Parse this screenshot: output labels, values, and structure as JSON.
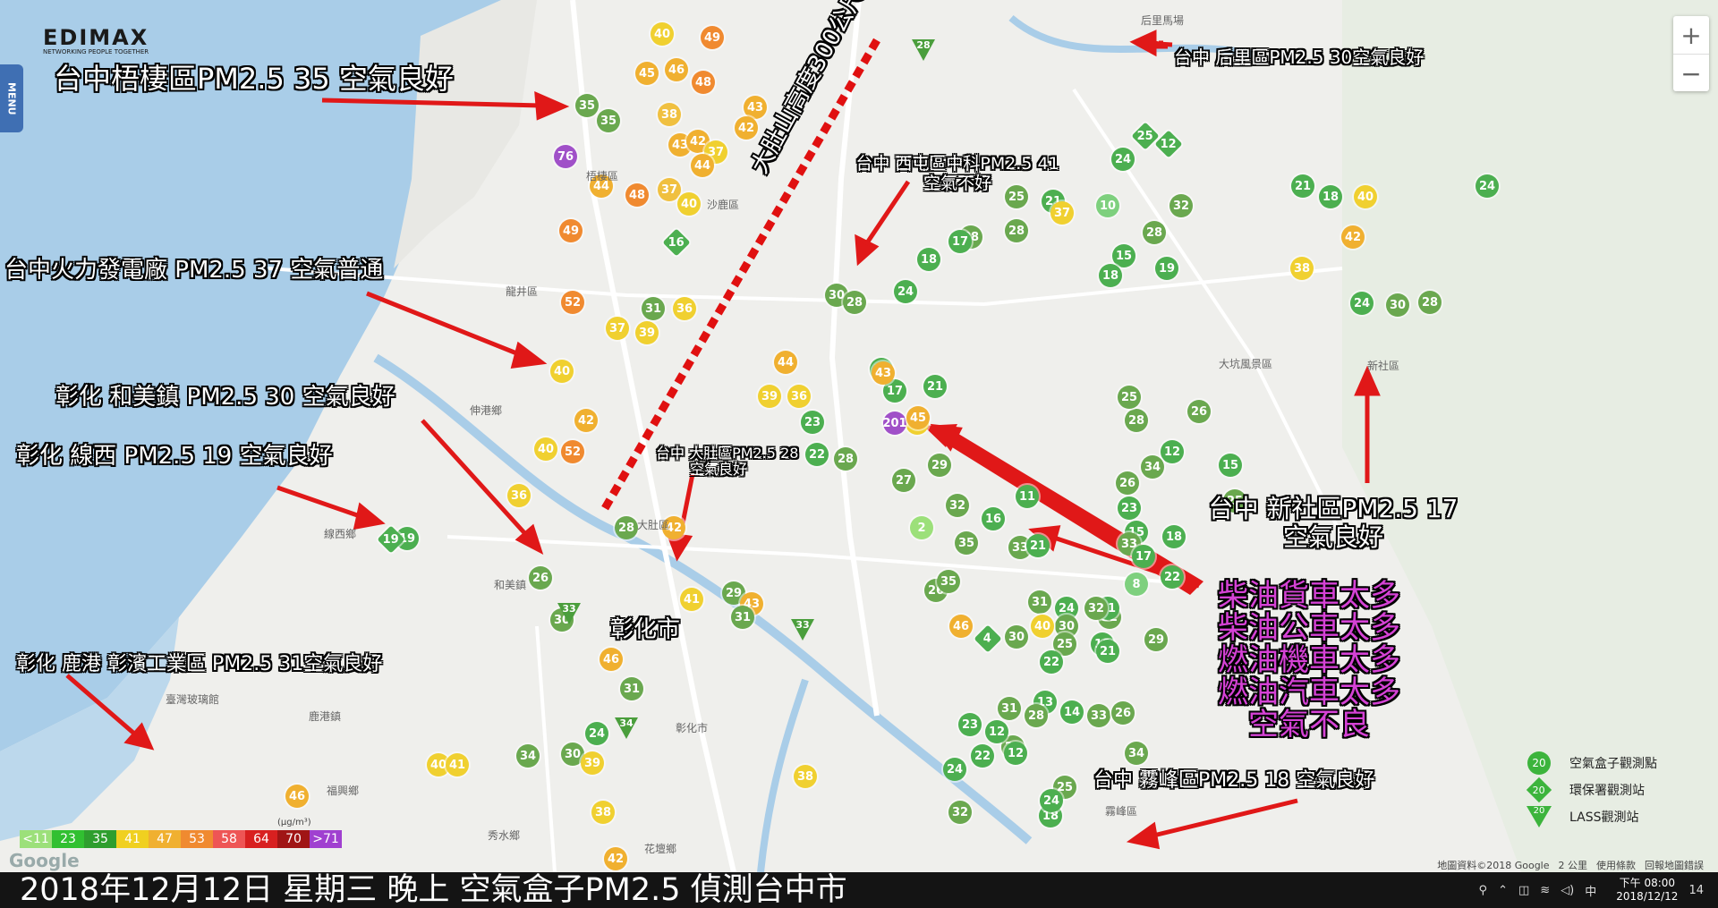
{
  "window": {
    "title": "空氣盒子PM2.5 地圖"
  },
  "brand": {
    "name": "EDIMAX",
    "tagline": "NETWORKING PEOPLE TOGETHER"
  },
  "menu_label": "MENU",
  "zoom": {
    "in": "+",
    "out": "−"
  },
  "annotations": {
    "wuqi": "台中梧棲區PM2.5  35 空氣良好",
    "power": "台中火力發電廠 PM2.5 37  空氣普通",
    "hemei": "彰化 和美鎮 PM2.5 30 空氣良好",
    "xianxi": "彰化 線西 PM2.5 19 空氣良好",
    "lukang": "彰化 鹿港 彰濱工業區 PM2.5 31空氣良好",
    "changhua": "彰化市",
    "dadu_line": "大肚山高度300公尺",
    "dadu": "台中 大肚區PM2.5 28",
    "dadu2": "空氣良好",
    "xitun": "台中 西屯區中科PM2.5 41",
    "xitun2": "空氣不好",
    "houli": "台中 后里區PM2.5 30空氣良好",
    "xinshe": "台中 新社區PM2.5 17",
    "xinshe2": "空氣良好",
    "causes": [
      "柴油貨車太多",
      "柴油公車太多",
      "燃油機車太多",
      "燃油汽車太多",
      "空氣不良"
    ],
    "wufeng": "台中 霧峰區PM2.5 18 空氣良好"
  },
  "map_labels": {
    "wuqi_town": "梧棲區",
    "shalu": "沙鹿區",
    "longjing": "龍井區",
    "shengang": "伸港鄉",
    "xianxi_town": "線西鄉",
    "dadu_town": "大肚區",
    "lukang_town": "鹿港鎮",
    "changhua_city": "彰化市",
    "dakeng": "大坑風景區",
    "xinshe_town": "新社區",
    "wufeng_town": "霧峰區",
    "houli_ranch": "后里馬場",
    "xiushui": "秀水鄉",
    "huatan": "花壇鄉",
    "hemei_town": "和美鎮",
    "fuxing": "福興鄉",
    "taiwan_glass": "臺灣玻璃館"
  },
  "legend": {
    "unit": "(μg/m³)",
    "items": [
      {
        "label": "<11",
        "color": "#9ce07a"
      },
      {
        "label": "23",
        "color": "#31c031"
      },
      {
        "label": "35",
        "color": "#2e9e2e"
      },
      {
        "label": "41",
        "color": "#f0d020"
      },
      {
        "label": "47",
        "color": "#f0b030"
      },
      {
        "label": "53",
        "color": "#f08a30"
      },
      {
        "label": "58",
        "color": "#ee5555"
      },
      {
        "label": "64",
        "color": "#d82020"
      },
      {
        "label": "70",
        "color": "#a01515"
      },
      {
        "label": ">71",
        "color": "#a040d0"
      }
    ]
  },
  "key": {
    "airbox": {
      "label": "空氣盒子觀測點",
      "value": "20"
    },
    "epa": {
      "label": "環保署觀測站",
      "value": "20"
    },
    "lass": {
      "label": "LASS觀測站",
      "value": "20"
    }
  },
  "attribution": {
    "data": "地圖資料©2018 Google",
    "scale": "2 公里",
    "terms": "使用條款",
    "report": "回報地圖錯誤"
  },
  "google": "Google",
  "footer": {
    "caption": "2018年12月12日 星期三  晚上 空氣盒子PM2.5 偵測台中市",
    "ime": "中",
    "time": "下午 08:00",
    "date": "2018/12/12",
    "notif": "14"
  },
  "pins": [
    {
      "v": "35",
      "c": "#6aa84f"
    },
    {
      "v": "35",
      "c": "#6aa84f"
    },
    {
      "v": "76",
      "c": "#a050c8"
    },
    {
      "v": "44",
      "c": "#f0b030"
    },
    {
      "v": "48",
      "c": "#f08a30"
    },
    {
      "v": "37",
      "c": "#f0c040"
    },
    {
      "v": "49",
      "c": "#f08a30"
    },
    {
      "v": "40",
      "c": "#f0d030"
    },
    {
      "v": "49",
      "c": "#f08a30"
    },
    {
      "v": "52",
      "c": "#f08a30"
    },
    {
      "v": "45",
      "c": "#f0b030"
    },
    {
      "v": "46",
      "c": "#f0b030"
    },
    {
      "v": "48",
      "c": "#f08a30"
    },
    {
      "v": "38",
      "c": "#f0c040"
    },
    {
      "v": "43",
      "c": "#f0b030"
    },
    {
      "v": "42",
      "c": "#f0b030"
    },
    {
      "v": "43",
      "c": "#f0b030"
    },
    {
      "v": "42",
      "c": "#f0b030"
    },
    {
      "v": "37",
      "c": "#f0d030"
    },
    {
      "v": "44",
      "c": "#f0b030"
    },
    {
      "v": "40",
      "c": "#f0d030"
    },
    {
      "v": "31",
      "c": "#6aa84f"
    },
    {
      "v": "36",
      "c": "#f0d030"
    },
    {
      "v": "39",
      "c": "#f0d030"
    },
    {
      "v": "37",
      "c": "#f0d030"
    },
    {
      "v": "40",
      "c": "#f0d030"
    },
    {
      "v": "42",
      "c": "#f0b030"
    },
    {
      "v": "40",
      "c": "#f0d030"
    },
    {
      "v": "52",
      "c": "#f08a30"
    },
    {
      "v": "36",
      "c": "#f0d030"
    },
    {
      "v": "28",
      "c": "#6aa84f"
    },
    {
      "v": "42",
      "c": "#f0b030"
    },
    {
      "v": "30",
      "c": "#6aa84f"
    },
    {
      "v": "26",
      "c": "#6aa84f"
    },
    {
      "v": "19",
      "c": "#4caf50"
    },
    {
      "v": "41",
      "c": "#f0d030"
    },
    {
      "v": "29",
      "c": "#6aa84f"
    },
    {
      "v": "43",
      "c": "#f0b030"
    },
    {
      "v": "46",
      "c": "#f0b030"
    },
    {
      "v": "31",
      "c": "#6aa84f"
    },
    {
      "v": "24",
      "c": "#4caf50"
    },
    {
      "v": "30",
      "c": "#6aa84f"
    },
    {
      "v": "39",
      "c": "#f0d030"
    },
    {
      "v": "34",
      "c": "#6aa84f"
    },
    {
      "v": "38",
      "c": "#f0d030"
    },
    {
      "v": "42",
      "c": "#f0b030"
    },
    {
      "v": "31",
      "c": "#6aa84f"
    },
    {
      "v": "40",
      "c": "#f0d030"
    },
    {
      "v": "41",
      "c": "#f0d030"
    },
    {
      "v": "46",
      "c": "#f0b030"
    },
    {
      "v": "38",
      "c": "#f0d030"
    },
    {
      "v": "30",
      "c": "#6aa84f"
    },
    {
      "v": "28",
      "c": "#6aa84f"
    },
    {
      "v": "24",
      "c": "#4caf50"
    },
    {
      "v": "41",
      "c": "#f0d030"
    },
    {
      "v": "19",
      "c": "#4caf50"
    },
    {
      "v": "17",
      "c": "#4caf50"
    },
    {
      "v": "21",
      "c": "#4caf50"
    },
    {
      "v": "201",
      "c": "#a050c8"
    },
    {
      "v": "43",
      "c": "#f0b030"
    },
    {
      "v": "45",
      "c": "#f0b030"
    },
    {
      "v": "44",
      "c": "#f0b030"
    },
    {
      "v": "39",
      "c": "#f0d030"
    },
    {
      "v": "36",
      "c": "#f0d030"
    },
    {
      "v": "23",
      "c": "#4caf50"
    },
    {
      "v": "22",
      "c": "#4caf50"
    },
    {
      "v": "28",
      "c": "#6aa84f"
    },
    {
      "v": "27",
      "c": "#6aa84f"
    },
    {
      "v": "29",
      "c": "#6aa84f"
    },
    {
      "v": "32",
      "c": "#6aa84f"
    },
    {
      "v": "35",
      "c": "#6aa84f"
    },
    {
      "v": "16",
      "c": "#4caf50"
    },
    {
      "v": "11",
      "c": "#4caf50"
    },
    {
      "v": "33",
      "c": "#6aa84f"
    },
    {
      "v": "21",
      "c": "#4caf50"
    },
    {
      "v": "24",
      "c": "#4caf50"
    },
    {
      "v": "30",
      "c": "#6aa84f"
    },
    {
      "v": "32",
      "c": "#6aa84f"
    },
    {
      "v": "25",
      "c": "#6aa84f"
    },
    {
      "v": "26",
      "c": "#6aa84f"
    },
    {
      "v": "12",
      "c": "#4caf50"
    },
    {
      "v": "23",
      "c": "#4caf50"
    },
    {
      "v": "34",
      "c": "#6aa84f"
    },
    {
      "v": "15",
      "c": "#4caf50"
    },
    {
      "v": "18",
      "c": "#4caf50"
    },
    {
      "v": "21",
      "c": "#4caf50"
    },
    {
      "v": "22",
      "c": "#4caf50"
    },
    {
      "v": "8",
      "c": "#7ed07e"
    },
    {
      "v": "28",
      "c": "#6aa84f"
    },
    {
      "v": "25",
      "c": "#6aa84f"
    },
    {
      "v": "26",
      "c": "#6aa84f"
    },
    {
      "v": "33",
      "c": "#6aa84f"
    },
    {
      "v": "18",
      "c": "#4caf50"
    },
    {
      "v": "15",
      "c": "#4caf50"
    },
    {
      "v": "25",
      "c": "#6aa84f"
    },
    {
      "v": "31",
      "c": "#6aa84f"
    },
    {
      "v": "40",
      "c": "#f0d030"
    },
    {
      "v": "22",
      "c": "#4caf50"
    },
    {
      "v": "13",
      "c": "#4caf50"
    },
    {
      "v": "14",
      "c": "#4caf50"
    },
    {
      "v": "33",
      "c": "#6aa84f"
    },
    {
      "v": "29",
      "c": "#6aa84f"
    },
    {
      "v": "21",
      "c": "#4caf50"
    },
    {
      "v": "17",
      "c": "#4caf50"
    },
    {
      "v": "32",
      "c": "#6aa84f"
    },
    {
      "v": "26",
      "c": "#6aa84f"
    },
    {
      "v": "34",
      "c": "#6aa84f"
    },
    {
      "v": "25",
      "c": "#6aa84f"
    },
    {
      "v": "18",
      "c": "#4caf50"
    },
    {
      "v": "24",
      "c": "#4caf50"
    },
    {
      "v": "28",
      "c": "#6aa84f"
    },
    {
      "v": "29",
      "c": "#6aa84f"
    },
    {
      "v": "31",
      "c": "#6aa84f"
    },
    {
      "v": "30",
      "c": "#6aa84f"
    },
    {
      "v": "24",
      "c": "#4caf50"
    },
    {
      "v": "32",
      "c": "#6aa84f"
    },
    {
      "v": "12",
      "c": "#4caf50"
    },
    {
      "v": "12",
      "c": "#4caf50"
    },
    {
      "v": "22",
      "c": "#4caf50"
    },
    {
      "v": "23",
      "c": "#4caf50"
    },
    {
      "v": "26",
      "c": "#6aa84f"
    },
    {
      "v": "35",
      "c": "#6aa84f"
    },
    {
      "v": "46",
      "c": "#f0b030"
    },
    {
      "v": "2",
      "c": "#9ce07a"
    },
    {
      "v": "28",
      "c": "#6aa84f"
    },
    {
      "v": "18",
      "c": "#4caf50"
    },
    {
      "v": "17",
      "c": "#4caf50"
    },
    {
      "v": "28",
      "c": "#6aa84f"
    },
    {
      "v": "25",
      "c": "#6aa84f"
    },
    {
      "v": "21",
      "c": "#4caf50"
    },
    {
      "v": "37",
      "c": "#f0d030"
    },
    {
      "v": "24",
      "c": "#4caf50"
    },
    {
      "v": "10",
      "c": "#7ed07e"
    },
    {
      "v": "32",
      "c": "#6aa84f"
    },
    {
      "v": "28",
      "c": "#6aa84f"
    },
    {
      "v": "15",
      "c": "#4caf50"
    },
    {
      "v": "18",
      "c": "#4caf50"
    },
    {
      "v": "19",
      "c": "#4caf50"
    },
    {
      "v": "21",
      "c": "#4caf50"
    },
    {
      "v": "18",
      "c": "#4caf50"
    },
    {
      "v": "40",
      "c": "#f0d030"
    },
    {
      "v": "42",
      "c": "#f0b030"
    },
    {
      "v": "38",
      "c": "#f0d030"
    },
    {
      "v": "24",
      "c": "#4caf50"
    },
    {
      "v": "30",
      "c": "#6aa84f"
    },
    {
      "v": "28",
      "c": "#6aa84f"
    },
    {
      "v": "24",
      "c": "#4caf50"
    }
  ],
  "stations_epa": [
    {
      "v": "19"
    },
    {
      "v": "16"
    },
    {
      "v": "12"
    },
    {
      "v": "25"
    },
    {
      "v": "4"
    }
  ],
  "stations_lass": [
    {
      "v": "33"
    },
    {
      "v": "28"
    },
    {
      "v": "33"
    },
    {
      "v": "34"
    }
  ]
}
